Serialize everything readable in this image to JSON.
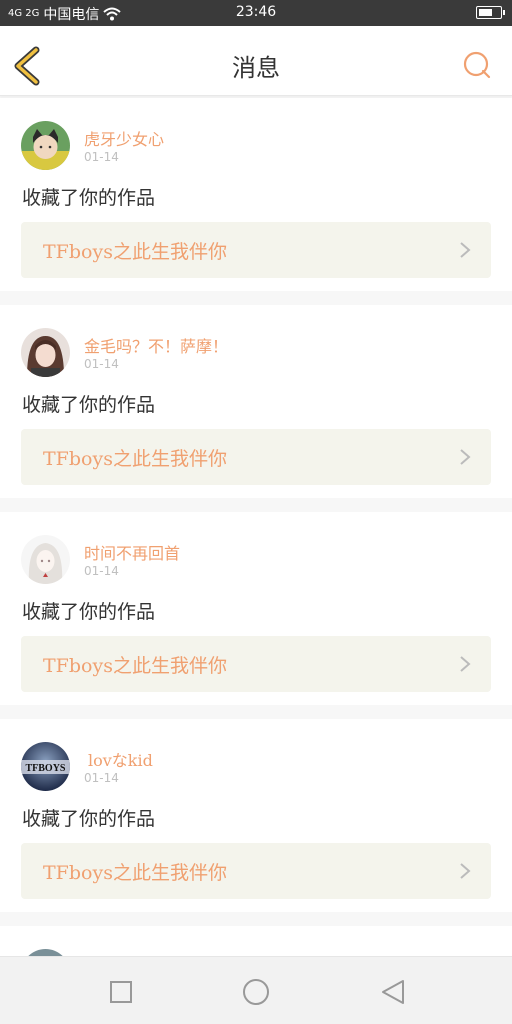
{
  "status_bar": {
    "signal": "4G 2G",
    "carrier": "中国电信",
    "time": "23:46"
  },
  "nav": {
    "title": "消息"
  },
  "colors": {
    "accent": "#f0a070",
    "back_icon": "#f0c040"
  },
  "messages": [
    {
      "username": "虎牙少女心",
      "date": "01-14",
      "action": "收藏了你的作品",
      "work_title": "TFboys之此生我伴你",
      "avatar_icon": "cat-ears-portrait-avatar"
    },
    {
      "username": "金毛吗？不！萨摩！",
      "date": "01-14",
      "action": "收藏了你的作品",
      "work_title": "TFboys之此生我伴你",
      "avatar_icon": "girl-portrait-avatar"
    },
    {
      "username": "时间不再回首",
      "date": "01-14",
      "action": "收藏了你的作品",
      "work_title": "TFboys之此生我伴你",
      "avatar_icon": "anime-girl-avatar"
    },
    {
      "username": "lovなkid",
      "date": "01-14",
      "action": "收藏了你的作品",
      "work_title": "TFboys之此生我伴你",
      "avatar_text": "TFBOYS",
      "avatar_icon": "tfboys-logo-avatar"
    }
  ]
}
